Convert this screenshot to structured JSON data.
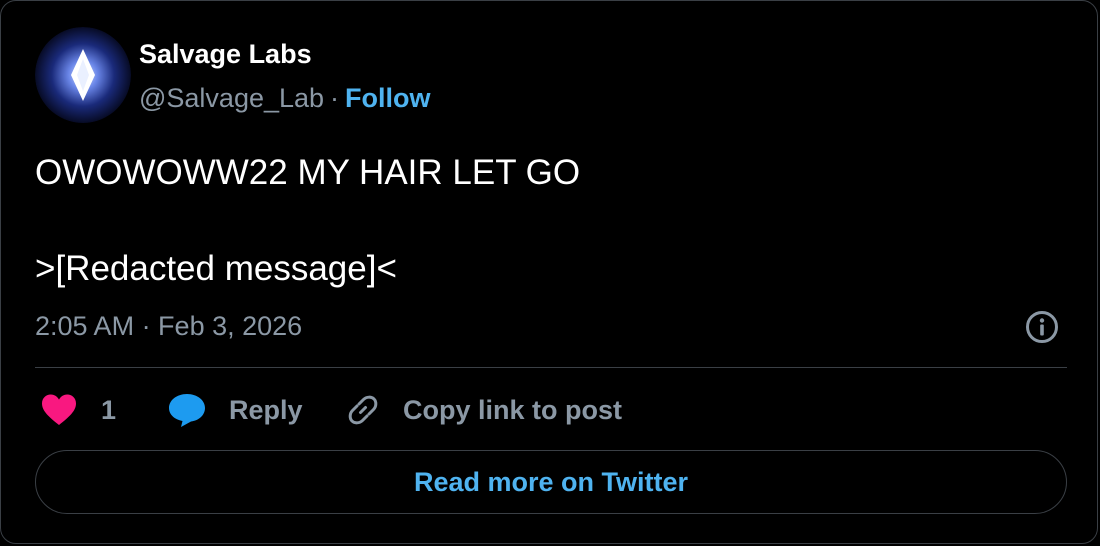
{
  "author": {
    "display_name": "Salvage Labs",
    "handle": "@Salvage_Lab",
    "separator": "·",
    "follow_label": "Follow",
    "avatar_icon": "sparkle-diamond-icon"
  },
  "tweet": {
    "line1": "OWOWOWW22 MY HAIR LET GO",
    "line2": ">[Redacted message]<",
    "timestamp": "2:05 AM · Feb 3, 2026"
  },
  "actions": {
    "like_count": "1",
    "reply_label": "Reply",
    "copy_link_label": "Copy link to post"
  },
  "footer": {
    "read_more_label": "Read more on Twitter"
  },
  "colors": {
    "background": "#000000",
    "accent_blue": "#4fb3f0",
    "muted_text": "#8b98a5",
    "like_pink": "#f91880",
    "reply_blue": "#1d9bf0",
    "border": "#3a3f45"
  }
}
